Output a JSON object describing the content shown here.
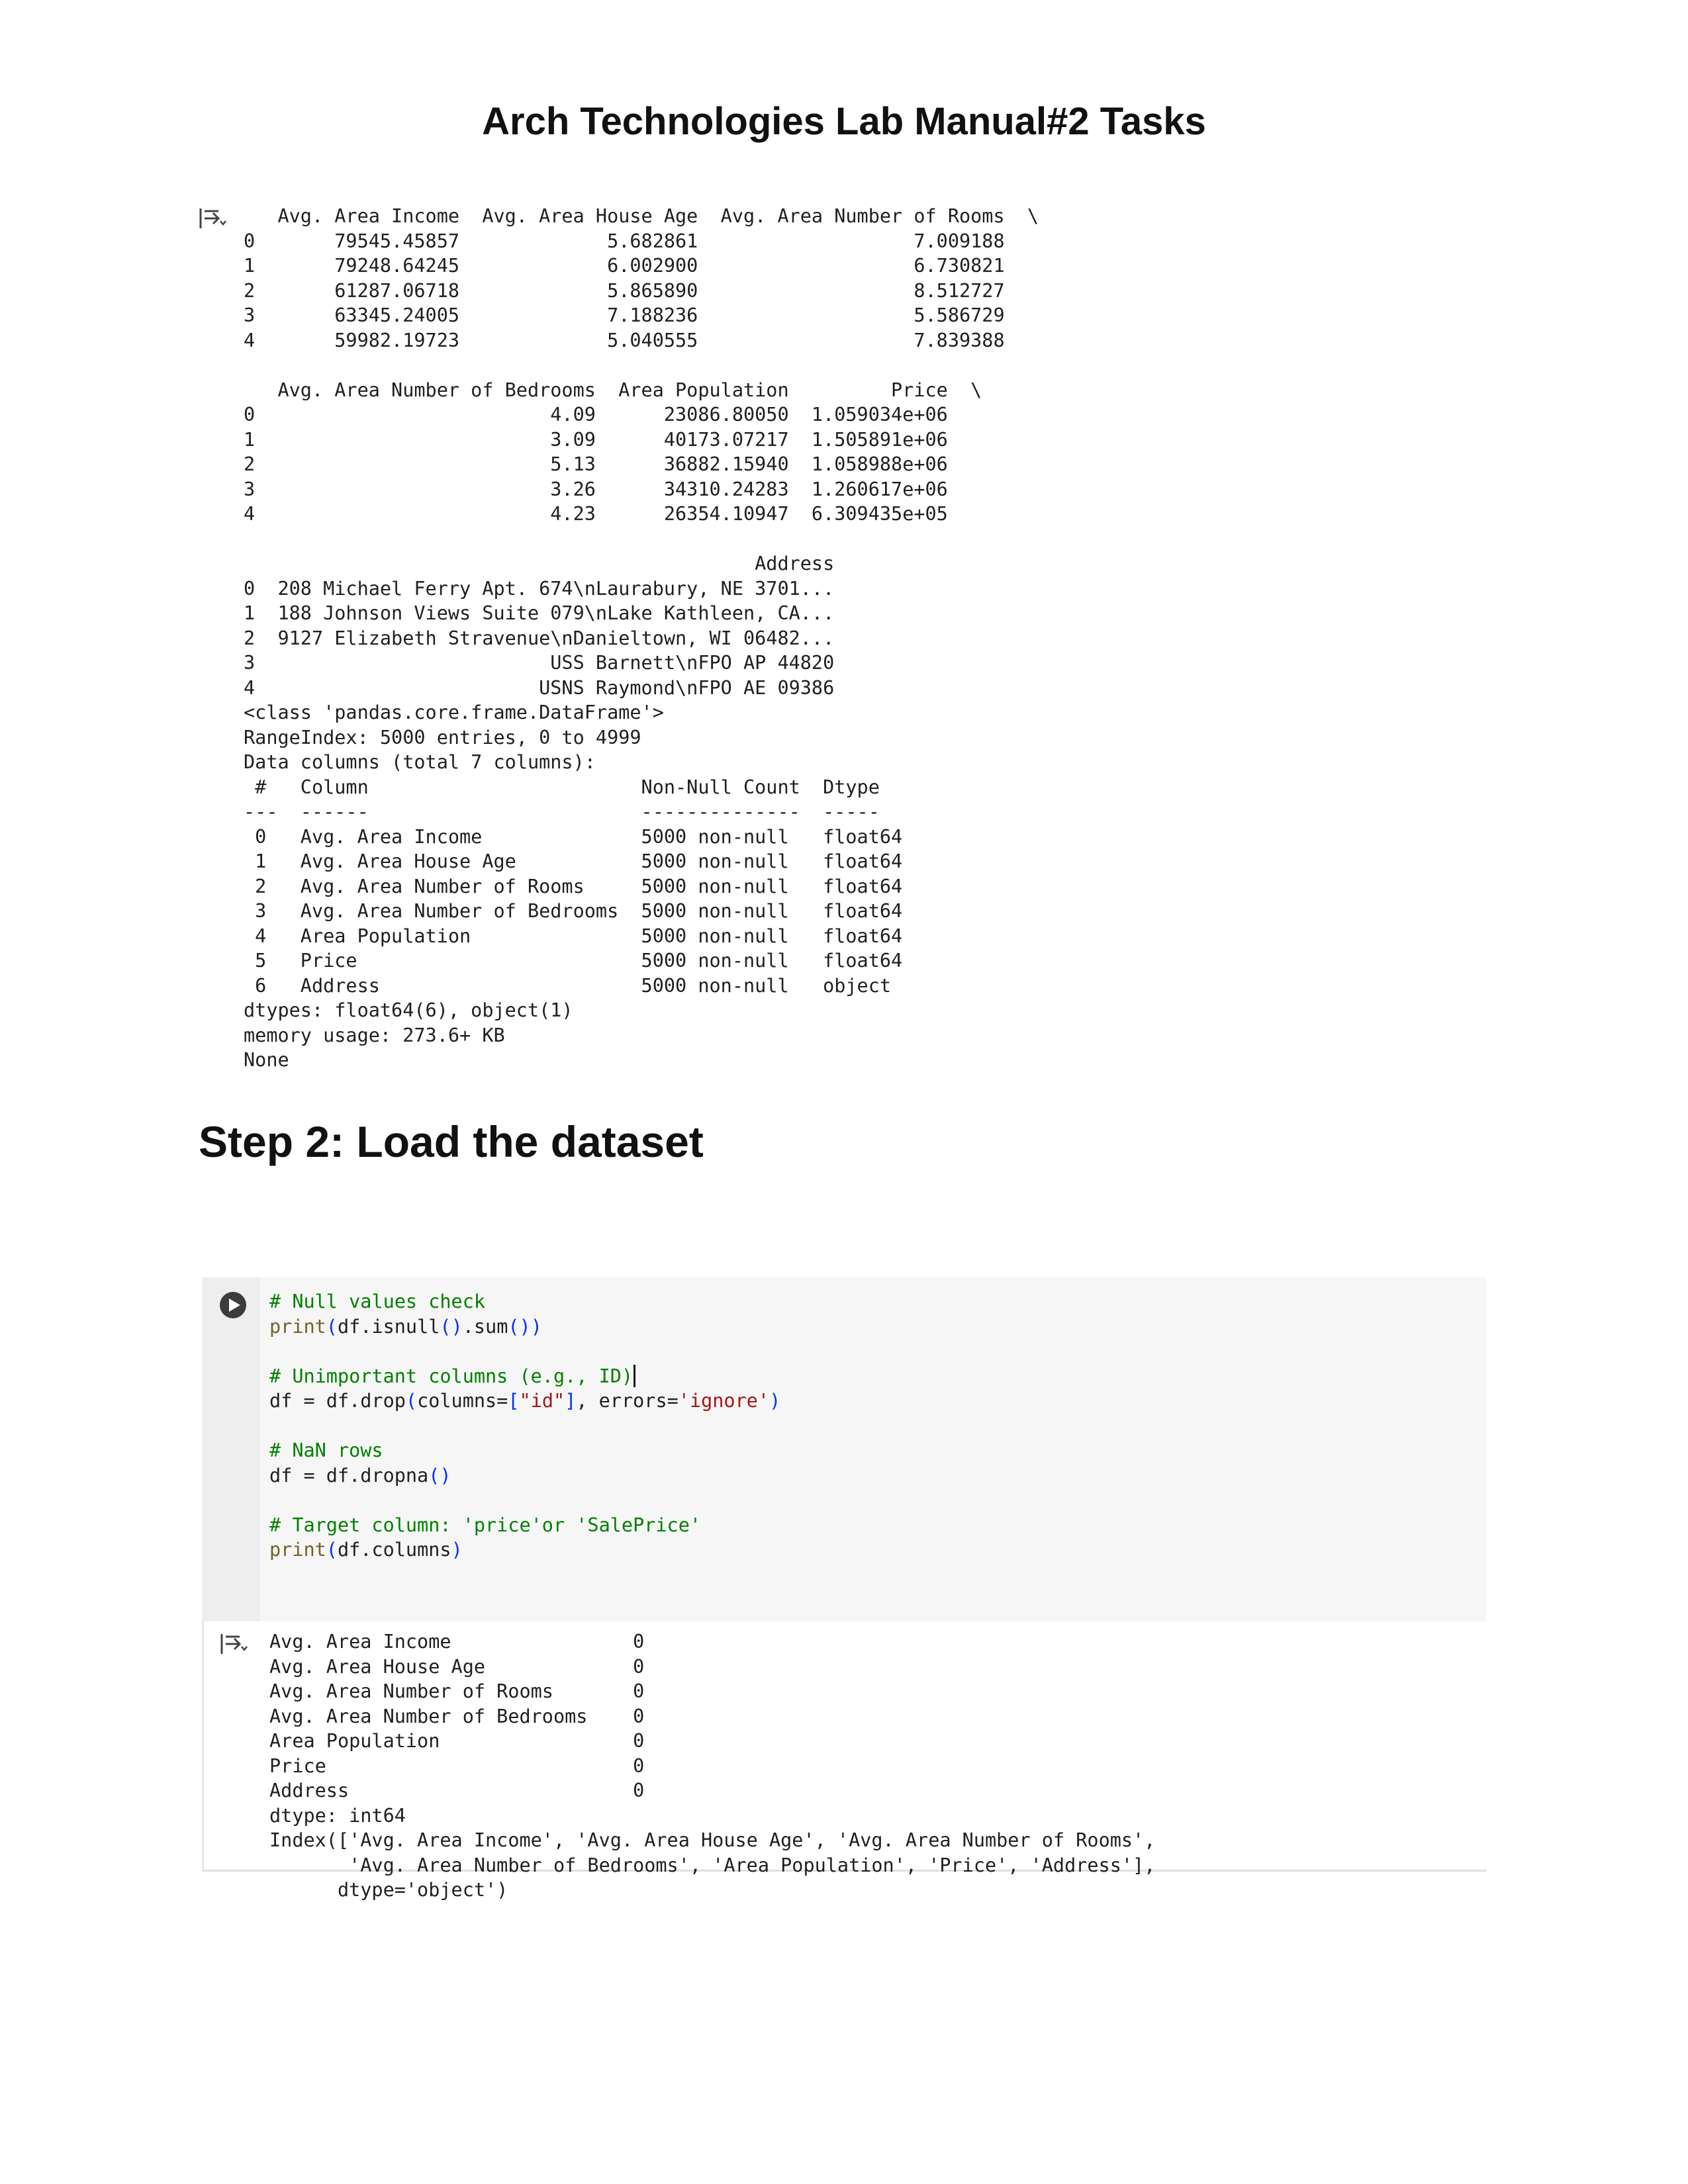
{
  "page": {
    "title": "Arch Technologies Lab Manual#2 Tasks"
  },
  "output1": {
    "icon": "output-collapse-icon",
    "lines": [
      "   Avg. Area Income  Avg. Area House Age  Avg. Area Number of Rooms  \\",
      "0       79545.45857             5.682861                   7.009188   ",
      "1       79248.64245             6.002900                   6.730821   ",
      "2       61287.06718             5.865890                   8.512727   ",
      "3       63345.24005             7.188236                   5.586729   ",
      "4       59982.19723             5.040555                   7.839388   ",
      "",
      "   Avg. Area Number of Bedrooms  Area Population         Price  \\",
      "0                          4.09      23086.80050  1.059034e+06   ",
      "1                          3.09      40173.07217  1.505891e+06   ",
      "2                          5.13      36882.15940  1.058988e+06   ",
      "3                          3.26      34310.24283  1.260617e+06   ",
      "4                          4.23      26354.10947  6.309435e+05   ",
      "",
      "                                             Address  ",
      "0  208 Michael Ferry Apt. 674\\nLaurabury, NE 3701...  ",
      "1  188 Johnson Views Suite 079\\nLake Kathleen, CA...  ",
      "2  9127 Elizabeth Stravenue\\nDanieltown, WI 06482...  ",
      "3                          USS Barnett\\nFPO AP 44820  ",
      "4                         USNS Raymond\\nFPO AE 09386  ",
      "<class 'pandas.core.frame.DataFrame'>",
      "RangeIndex: 5000 entries, 0 to 4999",
      "Data columns (total 7 columns):",
      " #   Column                        Non-Null Count  Dtype  ",
      "---  ------                        --------------  -----  ",
      " 0   Avg. Area Income              5000 non-null   float64",
      " 1   Avg. Area House Age           5000 non-null   float64",
      " 2   Avg. Area Number of Rooms     5000 non-null   float64",
      " 3   Avg. Area Number of Bedrooms  5000 non-null   float64",
      " 4   Area Population               5000 non-null   float64",
      " 5   Price                         5000 non-null   float64",
      " 6   Address                       5000 non-null   object ",
      "dtypes: float64(6), object(1)",
      "memory usage: 273.6+ KB",
      "None"
    ]
  },
  "step_heading": "Step 2: Load the dataset",
  "cell": {
    "run_icon": "run-cell-icon",
    "code": {
      "line1": "# Null values check",
      "line2_fn": "print",
      "line2_a": "(",
      "line2_b": "df.isnull",
      "line2_c": "()",
      "line2_d": ".sum",
      "line2_e": "())",
      "line4": "# Unimportant columns (e.g., ID)",
      "line5_a": "df = df.drop",
      "line5_b": "(",
      "line5_c": "columns=",
      "line5_d": "[",
      "line5_e": "\"id\"",
      "line5_f": "]",
      "line5_g": ", errors=",
      "line5_h": "'ignore'",
      "line5_i": ")",
      "line7": "# NaN rows",
      "line8_a": "df = df.dropna",
      "line8_b": "()",
      "line10": "# Target column: 'price'or 'SalePrice'",
      "line11_fn": "print",
      "line11_a": "(",
      "line11_b": "df.columns",
      "line11_c": ")"
    },
    "output_icon": "output-collapse-icon",
    "output_lines": [
      "Avg. Area Income                0",
      "Avg. Area House Age             0",
      "Avg. Area Number of Rooms       0",
      "Avg. Area Number of Bedrooms    0",
      "Area Population                 0",
      "Price                           0",
      "Address                         0",
      "dtype: int64",
      "Index(['Avg. Area Income', 'Avg. Area House Age', 'Avg. Area Number of Rooms',",
      "       'Avg. Area Number of Bedrooms', 'Area Population', 'Price', 'Address'],",
      "      dtype='object')"
    ]
  }
}
